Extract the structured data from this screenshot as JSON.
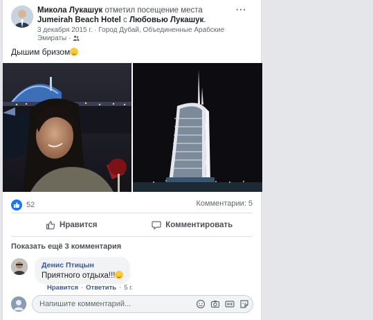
{
  "post": {
    "author": "Микола Лукашук",
    "action_text": "отметил посещение места",
    "place": "Jumeirah Beach Hotel",
    "with_text": "с",
    "tagged": "Любовью Лукашук",
    "period": ".",
    "date": "3 декабря 2015 г.",
    "separator": "·",
    "location": "Город Дубай, Объединенные Арабские Эмираты",
    "text": "Дышим бризом",
    "more_icon": "more-horizontal-icon"
  },
  "stats": {
    "likes": "52",
    "comments": "Комментарии: 5",
    "like_color": "#1877f2"
  },
  "actions": {
    "like": "Нравится",
    "comment": "Комментировать"
  },
  "comments_section": {
    "show_more": "Показать ещё 3 комментария",
    "comment": {
      "author": "Денис Птицын",
      "text": "Приятного отдыха!!!",
      "like": "Нравится",
      "reply": "Ответить",
      "dot": "·",
      "time": "5 г."
    }
  },
  "composer": {
    "placeholder": "Напишите комментарий...",
    "icons": [
      "emoji-icon",
      "camera-icon",
      "gif-icon",
      "sticker-icon"
    ]
  }
}
